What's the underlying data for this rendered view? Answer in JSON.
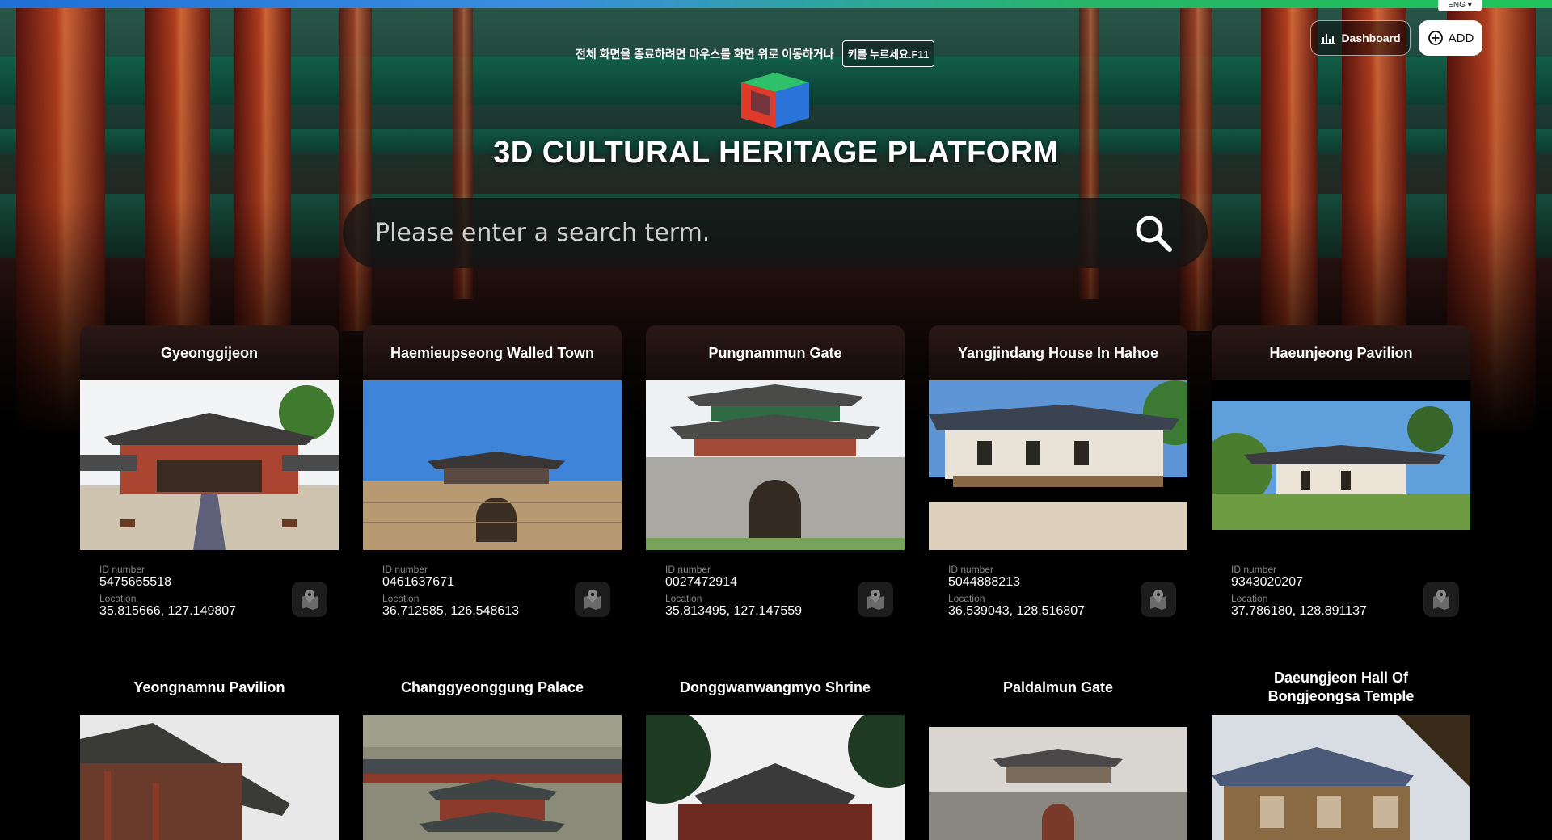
{
  "language": "ENG ▾",
  "notice": {
    "text": "전체 화면을 종료하려면 마우스를 화면 위로 이동하거나",
    "key": "키를 누르세요.F11"
  },
  "header": {
    "dashboard_label": "Dashboard",
    "add_label": "ADD"
  },
  "title": "3D CULTURAL HERITAGE PLATFORM",
  "search": {
    "placeholder": "Please enter a search term."
  },
  "labels": {
    "id": "ID number",
    "location": "Location"
  },
  "cards": [
    {
      "name": "Gyeonggijeon",
      "id": "5475665518",
      "location": "35.815666, 127.149807"
    },
    {
      "name": "Haemieupseong Walled Town",
      "id": "0461637671",
      "location": "36.712585, 126.548613"
    },
    {
      "name": "Pungnammun Gate",
      "id": "0027472914",
      "location": "35.813495, 127.147559"
    },
    {
      "name": "Yangjindang House In Hahoe",
      "id": "5044888213",
      "location": "36.539043, 128.516807"
    },
    {
      "name": "Haeunjeong Pavilion",
      "id": "9343020207",
      "location": "37.786180, 128.891137"
    }
  ],
  "cards_row2": [
    {
      "name": "Yeongnamnu Pavilion"
    },
    {
      "name": "Changgyeonggung Palace"
    },
    {
      "name": "Donggwanwangmyo Shrine"
    },
    {
      "name": "Paldalmun Gate"
    },
    {
      "name": "Daeungjeon Hall Of Bongjeongsa Temple"
    }
  ]
}
